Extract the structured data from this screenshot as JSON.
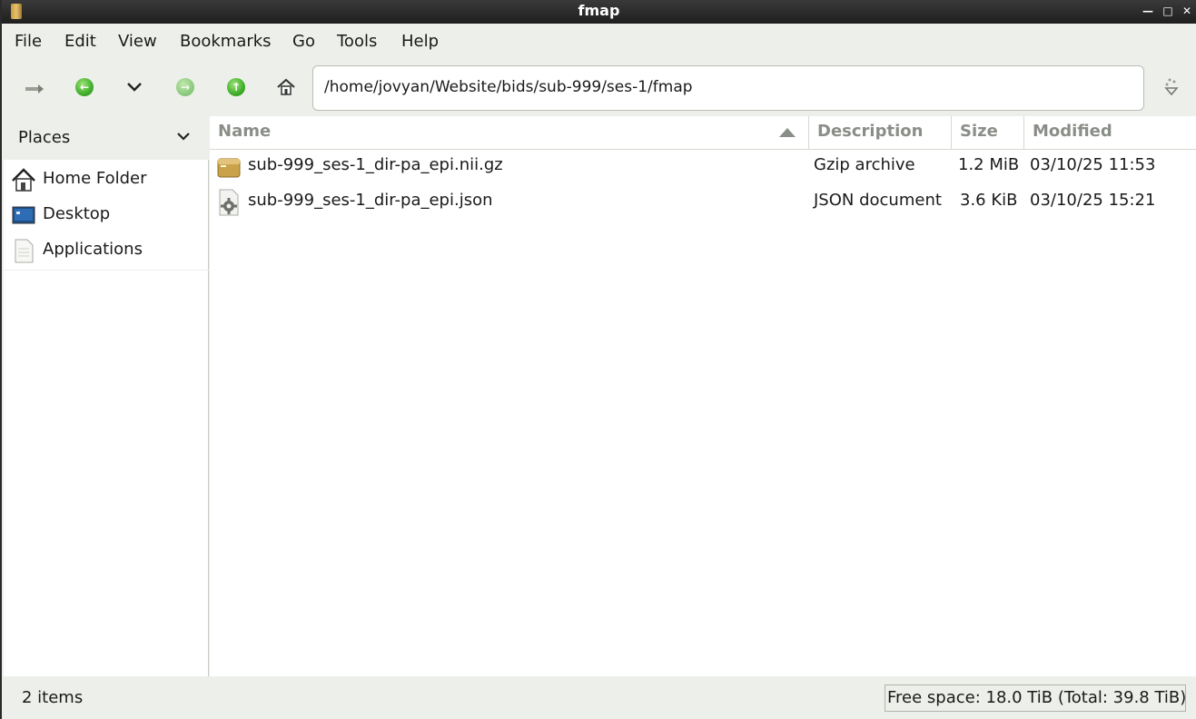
{
  "window": {
    "title": "fmap"
  },
  "menubar": {
    "items": [
      "File",
      "Edit",
      "View",
      "Bookmarks",
      "Go",
      "Tools",
      "Help"
    ]
  },
  "toolbar": {
    "location": "/home/jovyan/Website/bids/sub-999/ses-1/fmap"
  },
  "sidebar": {
    "header": "Places",
    "items": [
      {
        "label": "Home Folder",
        "icon": "home-icon"
      },
      {
        "label": "Desktop",
        "icon": "desktop-icon"
      },
      {
        "label": "Applications",
        "icon": "applications-icon"
      }
    ]
  },
  "filelist": {
    "columns": [
      "Name",
      "Description",
      "Size",
      "Modified"
    ],
    "sort_column": "Name",
    "rows": [
      {
        "name": "sub-999_ses-1_dir-pa_epi.nii.gz",
        "description": "Gzip archive",
        "size": "1.2 MiB",
        "modified": "03/10/25 11:53",
        "icon": "archive-icon"
      },
      {
        "name": "sub-999_ses-1_dir-pa_epi.json",
        "description": "JSON document",
        "size": "3.6 KiB",
        "modified": "03/10/25 15:21",
        "icon": "json-file-icon"
      }
    ]
  },
  "statusbar": {
    "count": "2 items",
    "free_space": "Free space: 18.0 TiB (Total: 39.8 TiB)"
  },
  "colors": {
    "accent_green": "#3fae2a",
    "window_bg": "#edf0ea",
    "titlebar_bg": "#1e1e1e"
  }
}
